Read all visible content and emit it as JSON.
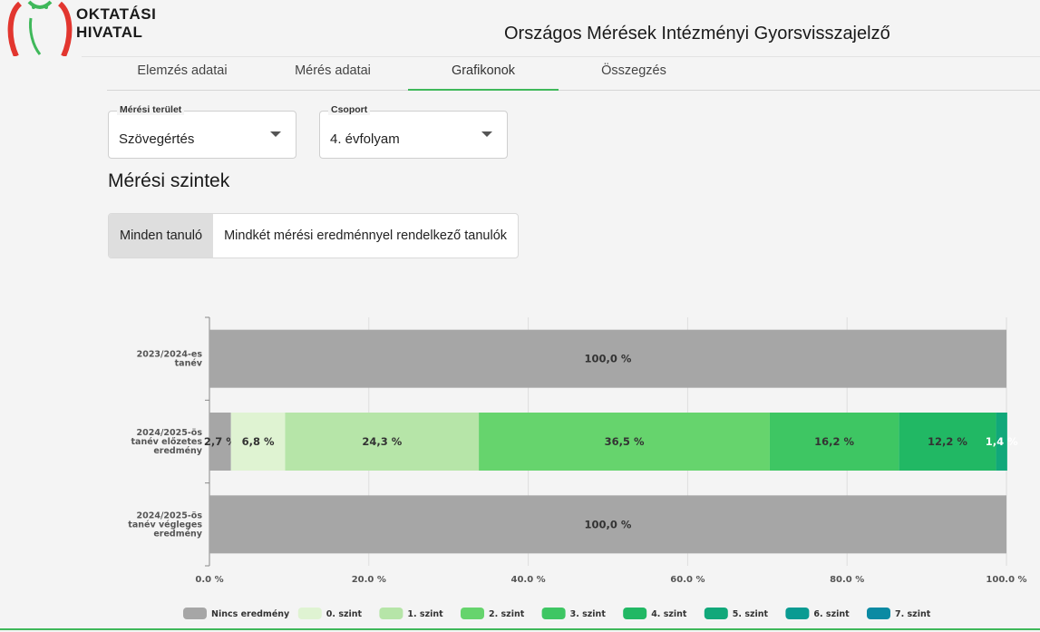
{
  "header": {
    "logo_line1": "OKTATÁSI",
    "logo_line2": "HIVATAL",
    "app_title": "Országos Mérések Intézményi Gyorsvisszajelző"
  },
  "tabs": [
    {
      "label": "Elemzés adatai"
    },
    {
      "label": "Mérés adatai"
    },
    {
      "label": "Grafikonok",
      "active": true
    },
    {
      "label": "Összegzés"
    }
  ],
  "filters": {
    "area": {
      "label": "Mérési terület",
      "value": "Szövegértés"
    },
    "group": {
      "label": "Csoport",
      "value": "4. évfolyam"
    }
  },
  "section_title": "Mérési szintek",
  "toggle": {
    "all_students": "Minden tanuló",
    "both_results": "Mindkét mérési eredménnyel rendelkező tanulók"
  },
  "colors": {
    "brand_green": "#3fb85a",
    "logo_red": "#e2362f",
    "grid": "#dddddd"
  },
  "chart_data": {
    "type": "bar",
    "orientation": "horizontal",
    "stacked": true,
    "xlim": [
      0,
      100
    ],
    "x_ticks": [
      "0.0 %",
      "20.0 %",
      "40.0 %",
      "60.0 %",
      "80.0 %",
      "100.0 %"
    ],
    "categories": [
      [
        "2023/2024-es",
        "tanév"
      ],
      [
        "2024/2025-ös",
        "tanév előzetes",
        "eredmény"
      ],
      [
        "2024/2025-ös",
        "tanév végleges",
        "eredmény"
      ]
    ],
    "series": [
      {
        "name": "Nincs eredmény",
        "color": "#a6a6a6",
        "values": [
          100,
          2.7,
          100
        ],
        "labels": [
          "100,0 %",
          "2,7 %",
          "100,0 %"
        ]
      },
      {
        "name": "0. szint",
        "color": "#dff3d2",
        "values": [
          0,
          6.8,
          0
        ],
        "labels": [
          "",
          "6,8 %",
          ""
        ]
      },
      {
        "name": "1. szint",
        "color": "#b6e5a8",
        "values": [
          0,
          24.3,
          0
        ],
        "labels": [
          "",
          "24,3 %",
          ""
        ]
      },
      {
        "name": "2. szint",
        "color": "#66d46d",
        "values": [
          0,
          36.5,
          0
        ],
        "labels": [
          "",
          "36,5 %",
          ""
        ]
      },
      {
        "name": "3. szint",
        "color": "#3ec663",
        "values": [
          0,
          16.2,
          0
        ],
        "labels": [
          "",
          "16,2 %",
          ""
        ]
      },
      {
        "name": "4. szint",
        "color": "#21b864",
        "values": [
          0,
          12.2,
          0
        ],
        "labels": [
          "",
          "12,2 %",
          ""
        ]
      },
      {
        "name": "5. szint",
        "color": "#11a87a",
        "values": [
          0,
          1.4,
          0
        ],
        "labels": [
          "",
          "1,4 %",
          ""
        ]
      },
      {
        "name": "6. szint",
        "color": "#0a9b92",
        "values": [
          0,
          0,
          0
        ],
        "labels": [
          "",
          "",
          ""
        ]
      },
      {
        "name": "7. szint",
        "color": "#0b8aa3",
        "values": [
          0,
          0,
          0
        ],
        "labels": [
          "",
          "",
          ""
        ]
      }
    ]
  }
}
